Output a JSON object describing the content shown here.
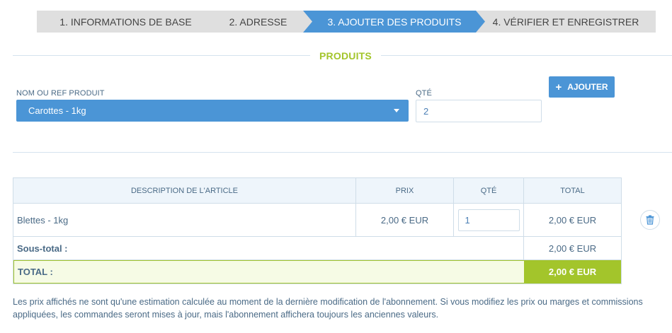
{
  "wizard": {
    "steps": [
      {
        "label": "1. INFORMATIONS DE BASE"
      },
      {
        "label": "2. ADRESSE"
      },
      {
        "label": "3. AJOUTER DES PRODUITS"
      },
      {
        "label": "4. VÉRIFIER ET ENREGISTRER"
      }
    ],
    "active_index": 2
  },
  "section": {
    "title": "PRODUITS"
  },
  "form": {
    "product_label": "NOM OU REF PRODUIT",
    "product_value": "Carottes - 1kg",
    "qty_label": "QTÉ",
    "qty_value": "2",
    "add_label": "AJOUTER",
    "add_icon": "plus-icon"
  },
  "table": {
    "headers": [
      "DESCRIPTION DE L'ARTICLE",
      "PRIX",
      "QTÉ",
      "TOTAL"
    ],
    "rows": [
      {
        "description": "Blettes - 1kg",
        "price": "2,00 € EUR",
        "qty": "1",
        "total": "2,00 € EUR"
      }
    ],
    "subtotal_label": "Sous-total :",
    "subtotal_value": "2,00 € EUR",
    "total_label": "TOTAL :",
    "total_value": "2,00 € EUR",
    "delete_icon": "trash-icon"
  },
  "note": "Les prix affichés ne sont qu'une estimation calculée au moment de la dernière modification de l'abonnement. Si vous modifiez les prix ou marges et commissions appliquées, les commandes seront mises à jour, mais l'abonnement affichera toujours les anciennes valeurs.",
  "colors": {
    "accent": "#4b95d6",
    "green": "#a3c52b",
    "step_bg": "#dfdfdf"
  }
}
